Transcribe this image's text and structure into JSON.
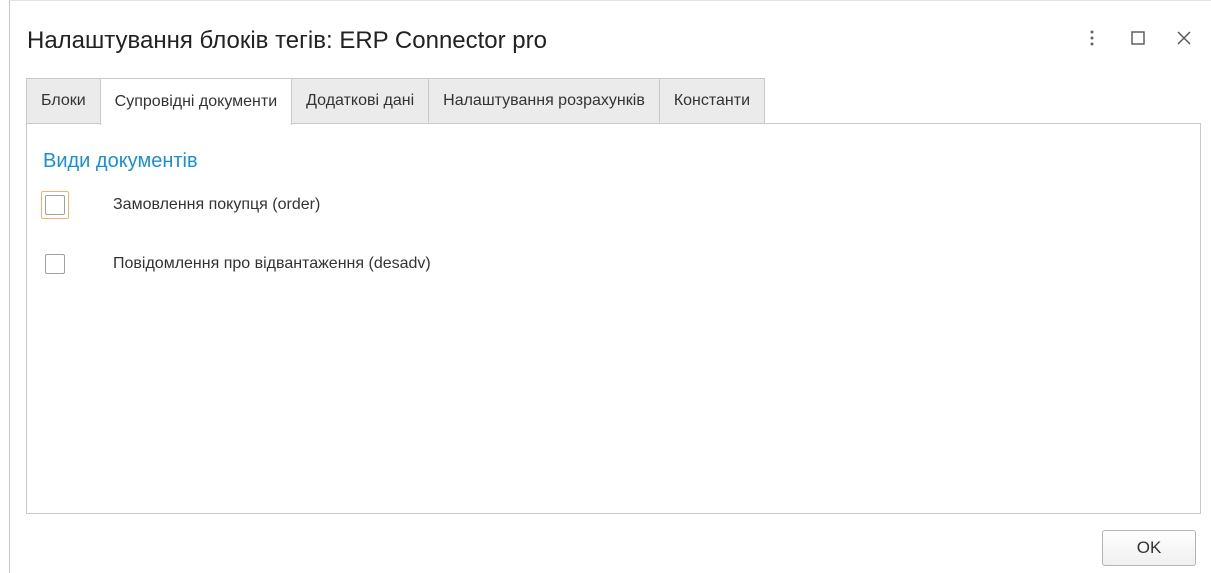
{
  "window": {
    "title": "Налаштування блоків тегів: ERP Connector pro",
    "controls": {
      "more": "more-vertical-icon",
      "maximize": "maximize-icon",
      "close": "close-icon"
    }
  },
  "tabs": [
    {
      "label": "Блоки",
      "active": false
    },
    {
      "label": "Супровідні документи",
      "active": true
    },
    {
      "label": "Додаткові дані",
      "active": false
    },
    {
      "label": "Налаштування розрахунків",
      "active": false
    },
    {
      "label": "Константи",
      "active": false
    }
  ],
  "section": {
    "title": "Види документів",
    "items": [
      {
        "label": "Замовлення покупця (order)",
        "checked": false,
        "focused": true
      },
      {
        "label": "Повідомлення про відвантаження (desadv)",
        "checked": false,
        "focused": false
      }
    ]
  },
  "footer": {
    "ok_label": "OK"
  },
  "colors": {
    "accent": "#1a8fd6",
    "focus": "#f0b272",
    "tab_inactive": "#ebebeb"
  }
}
